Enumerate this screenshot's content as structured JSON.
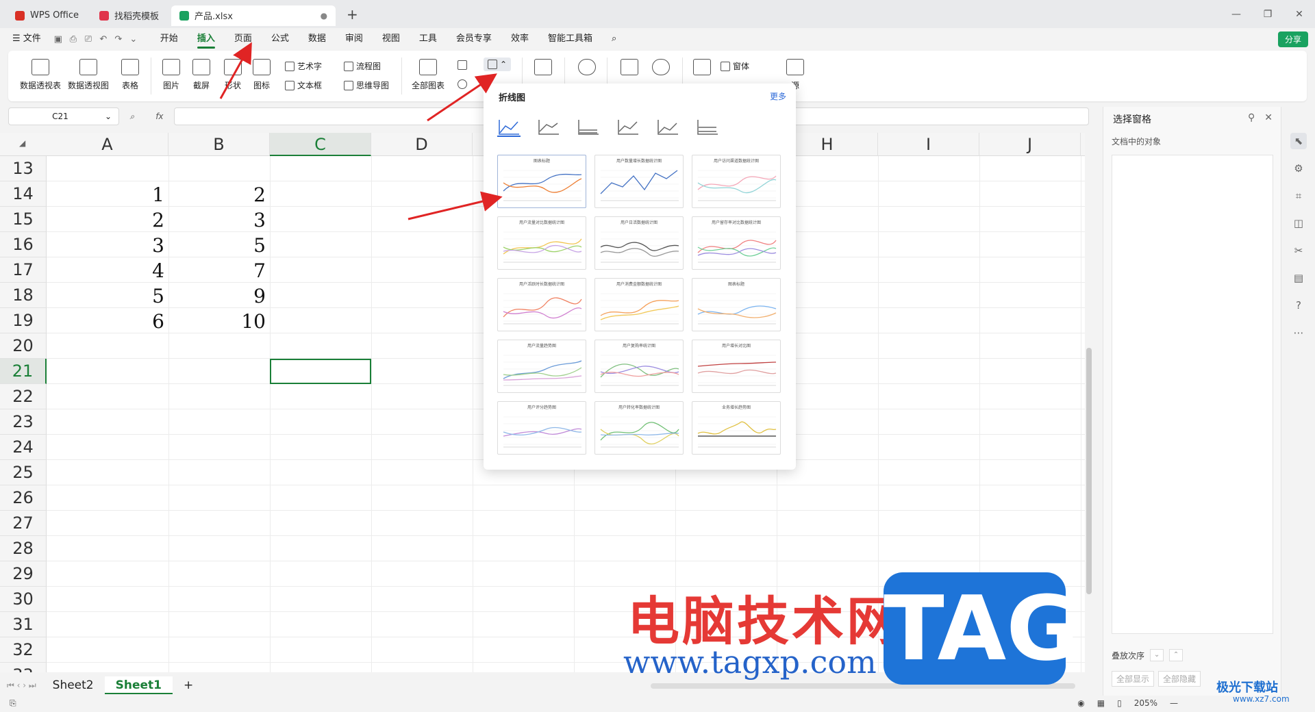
{
  "titlebar": {
    "tabs": [
      {
        "label": "WPS Office",
        "color": "#d93025"
      },
      {
        "label": "找稻壳模板",
        "color": "#e0344b"
      },
      {
        "label": "产品.xlsx",
        "color": "#1aa260"
      }
    ],
    "plus": "+"
  },
  "menubar": {
    "file": "☰ 文件",
    "items": [
      "开始",
      "插入",
      "页面",
      "公式",
      "数据",
      "审阅",
      "视图",
      "工具",
      "会员专享",
      "效率",
      "智能工具箱"
    ],
    "active": "插入",
    "share": "分享"
  },
  "ribbon": {
    "pivot_table": "数据透视表",
    "pivot_chart": "数据透视图",
    "table": "表格",
    "picture": "图片",
    "screenshot": "截屏",
    "shape": "形状",
    "icon": "图标",
    "art_text": "艺术字",
    "textbox": "文本框",
    "flowchart": "流程图",
    "mindmap": "思维导图",
    "all_charts": "全部图表",
    "window": "窗体",
    "source": "源"
  },
  "formula": {
    "namebox": "C21",
    "fx": "fx"
  },
  "grid": {
    "columns": [
      "A",
      "B",
      "C",
      "D",
      "E",
      "F",
      "G",
      "H",
      "I",
      "J"
    ],
    "rows": [
      "13",
      "14",
      "15",
      "16",
      "17",
      "18",
      "19",
      "20",
      "21",
      "22",
      "23",
      "24",
      "25",
      "26",
      "27",
      "28",
      "29",
      "30",
      "31",
      "32",
      "33"
    ],
    "active_cell": "C21",
    "cells": [
      {
        "row": "14",
        "a": "1",
        "b": "2"
      },
      {
        "row": "15",
        "a": "2",
        "b": "3"
      },
      {
        "row": "16",
        "a": "3",
        "b": "5"
      },
      {
        "row": "17",
        "a": "4",
        "b": "7"
      },
      {
        "row": "18",
        "a": "5",
        "b": "9"
      },
      {
        "row": "19",
        "a": "6",
        "b": "10"
      }
    ]
  },
  "sheets": {
    "tabs": [
      "Sheet2",
      "Sheet1"
    ],
    "active": "Sheet1",
    "add": "+"
  },
  "status": {
    "zoom": "205%"
  },
  "pane": {
    "title": "选择窗格",
    "subtitle": "文档中的对象",
    "order_label": "叠放次序",
    "show_all": "全部显示",
    "hide_all": "全部隐藏"
  },
  "dropdown": {
    "title": "折线图",
    "more": "更多",
    "accent": "#2e6ad8",
    "thumb_titles": [
      "图表标题",
      "用户数量增长数据统计图",
      "用户访问渠道数据统计图",
      "用户流量对比数据统计图",
      "用户日活数据统计图",
      "用户留存率对比数据统计图",
      "用户活跃时长数据统计图",
      "用户消费金额数据统计图",
      "图表标题",
      "用户流量趋势图",
      "用户复购率统计图",
      "用户增长对比图",
      "用户评分趋势图",
      "用户转化率数据统计图",
      "业务增长趋势图"
    ]
  },
  "watermark": {
    "cn": "电脑技术网",
    "url": "www.tagxp.com",
    "tag": "TAG",
    "xz": "极光下载站",
    "xz_url": "www.xz7.com"
  }
}
